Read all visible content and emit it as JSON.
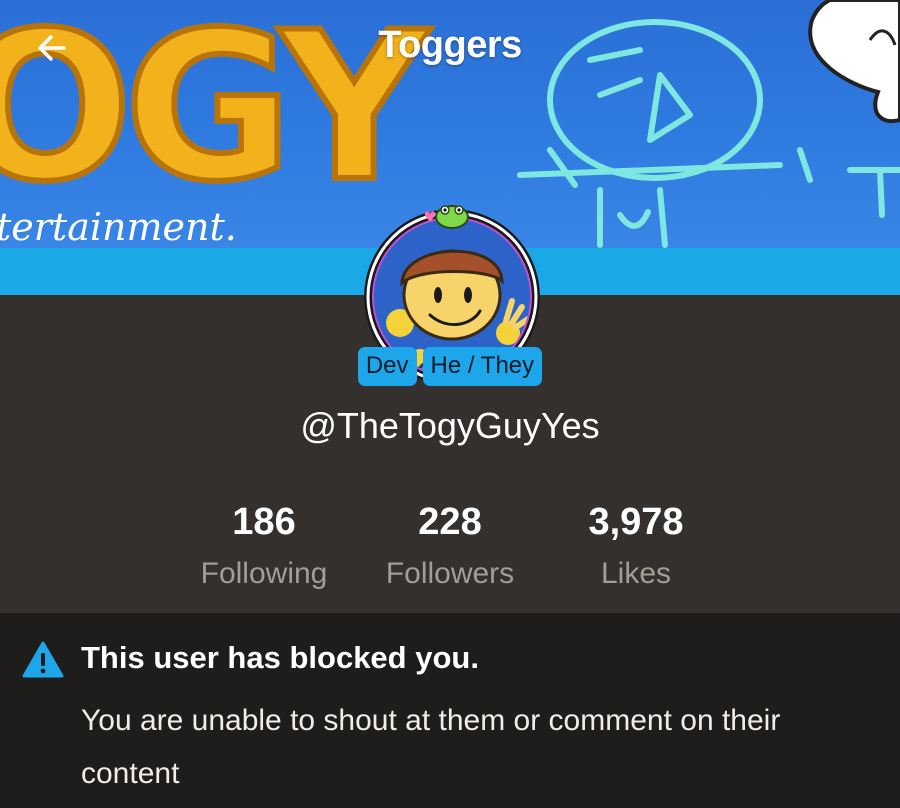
{
  "header": {
    "title": "Toggers",
    "back_icon": "arrow-left-icon",
    "more_icon": "more-vertical-icon"
  },
  "banner": {
    "logo_text": "OGY",
    "caption": "tertainment."
  },
  "profile": {
    "badges": [
      {
        "label": "Dev"
      },
      {
        "label": "He / They"
      }
    ],
    "username": "@TheTogyGuyYes"
  },
  "stats": [
    {
      "value": "186",
      "label": "Following"
    },
    {
      "value": "228",
      "label": "Followers"
    },
    {
      "value": "3,978",
      "label": "Likes"
    }
  ],
  "notice": {
    "icon": "warning-triangle-icon",
    "title": "This user has blocked you.",
    "body": "You are unable to shout at them or comment on their content"
  },
  "colors": {
    "background": "#34302d",
    "notice_background": "#1f1d1c",
    "accent": "#1ea6ea",
    "muted_text": "#a39d97"
  }
}
